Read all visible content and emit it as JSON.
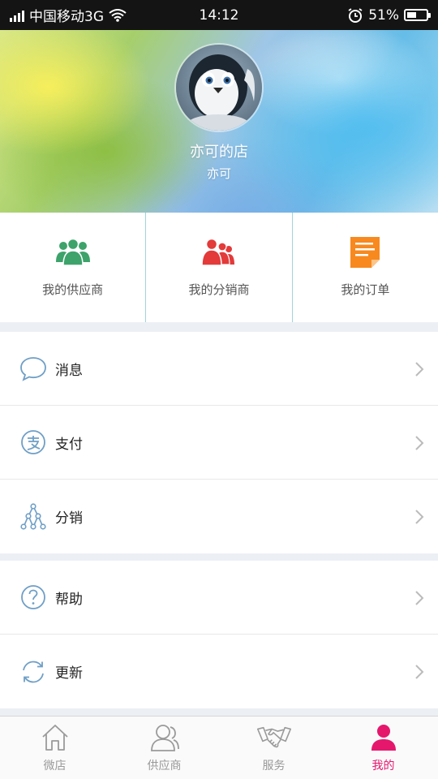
{
  "status_bar": {
    "carrier": "中国移动3G",
    "time": "14:12",
    "battery": "51%",
    "battery_level": 0.51
  },
  "profile": {
    "shop_name": "亦可的店",
    "user_name": "亦可"
  },
  "quick_links": [
    {
      "label": "我的供应商",
      "icon": "suppliers-icon",
      "color": "#3da36b"
    },
    {
      "label": "我的分销商",
      "icon": "distributors-icon",
      "color": "#e33a3a"
    },
    {
      "label": "我的订单",
      "icon": "orders-icon",
      "color": "#f7891f"
    }
  ],
  "menu_group_1": [
    {
      "label": "消息",
      "icon": "message-icon"
    },
    {
      "label": "支付",
      "icon": "payment-icon"
    },
    {
      "label": "分销",
      "icon": "distribution-icon"
    }
  ],
  "menu_group_2": [
    {
      "label": "帮助",
      "icon": "help-icon"
    },
    {
      "label": "更新",
      "icon": "update-icon"
    }
  ],
  "tabbar": {
    "items": [
      {
        "label": "微店",
        "icon": "shop-home-icon"
      },
      {
        "label": "供应商",
        "icon": "supplier-person-icon"
      },
      {
        "label": "服务",
        "icon": "handshake-icon"
      },
      {
        "label": "我的",
        "icon": "user-icon"
      }
    ],
    "active_index": 3,
    "active_color": "#e5176d"
  }
}
